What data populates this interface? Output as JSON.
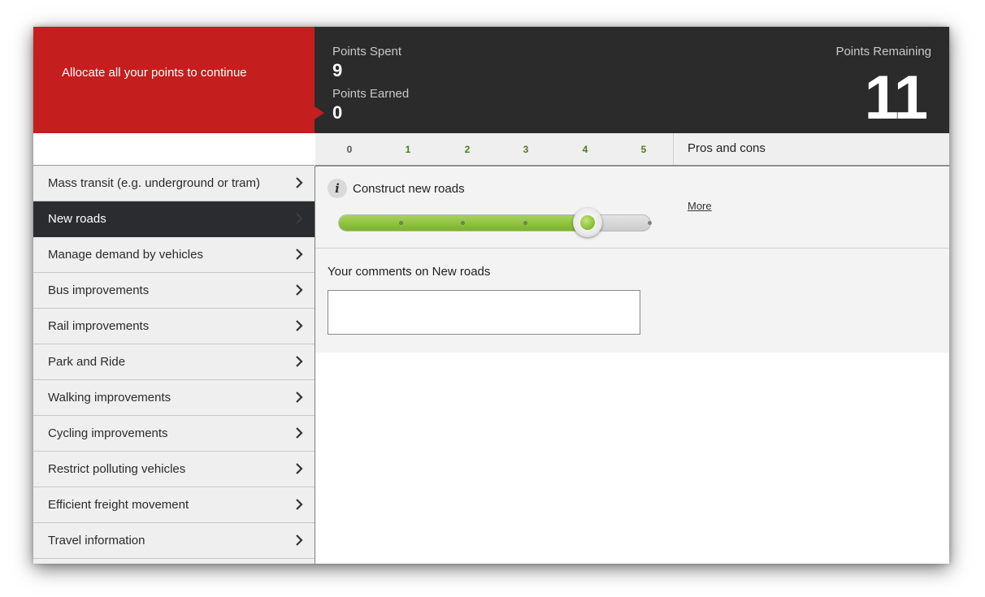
{
  "header": {
    "alert_message": "Allocate all your points to continue",
    "points_spent_label": "Points Spent",
    "points_spent": "9",
    "points_earned_label": "Points Earned",
    "points_earned": "0",
    "points_remaining_label": "Points Remaining",
    "points_remaining": "11",
    "alert_color": "#c41e1e",
    "header_bg": "#2b2b2b"
  },
  "scale": {
    "values": [
      "0",
      "1",
      "2",
      "3",
      "4",
      "5"
    ],
    "pros_cons_label": "Pros and cons",
    "zero_color": "#555555",
    "value_color": "#4e7a1e"
  },
  "sidebar": {
    "items": [
      {
        "label": "Mass transit (e.g. underground or tram)",
        "active": false
      },
      {
        "label": "New roads",
        "active": true
      },
      {
        "label": "Manage demand by vehicles",
        "active": false
      },
      {
        "label": "Bus improvements",
        "active": false
      },
      {
        "label": "Rail improvements",
        "active": false
      },
      {
        "label": "Park and Ride",
        "active": false
      },
      {
        "label": "Walking improvements",
        "active": false
      },
      {
        "label": "Cycling improvements",
        "active": false
      },
      {
        "label": "Restrict polluting vehicles",
        "active": false
      },
      {
        "label": "Efficient freight movement",
        "active": false
      },
      {
        "label": "Travel information",
        "active": false
      }
    ],
    "chevron_icon": "chevron-right-icon"
  },
  "main": {
    "info_icon": "info-icon",
    "info_glyph": "i",
    "option_title": "Construct new roads",
    "more_link": "More",
    "slider": {
      "min": 0,
      "max": 4,
      "value": 3,
      "accent": "#8cc63f"
    },
    "comments_label": "Your comments on New roads",
    "comments_value": ""
  }
}
